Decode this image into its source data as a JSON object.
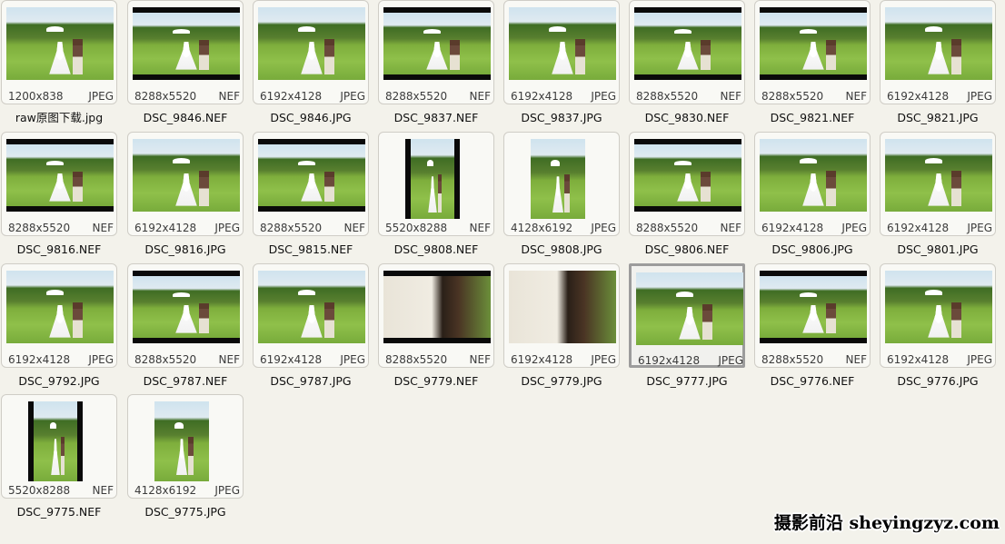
{
  "items": [
    {
      "name": "raw原图下载.jpg",
      "dims": "1200x838",
      "type": "JPEG",
      "thumb": "square",
      "selected": false
    },
    {
      "name": "DSC_9846.NEF",
      "dims": "8288x5520",
      "type": "NEF",
      "thumb": "landscape-letterbox",
      "selected": false
    },
    {
      "name": "DSC_9846.JPG",
      "dims": "6192x4128",
      "type": "JPEG",
      "thumb": "landscape",
      "selected": false
    },
    {
      "name": "DSC_9837.NEF",
      "dims": "8288x5520",
      "type": "NEF",
      "thumb": "landscape-letterbox",
      "selected": false
    },
    {
      "name": "DSC_9837.JPG",
      "dims": "6192x4128",
      "type": "JPEG",
      "thumb": "landscape",
      "selected": false
    },
    {
      "name": "DSC_9830.NEF",
      "dims": "8288x5520",
      "type": "NEF",
      "thumb": "landscape-letterbox",
      "selected": false
    },
    {
      "name": "DSC_9821.NEF",
      "dims": "8288x5520",
      "type": "NEF",
      "thumb": "landscape-letterbox",
      "selected": false
    },
    {
      "name": "DSC_9821.JPG",
      "dims": "6192x4128",
      "type": "JPEG",
      "thumb": "landscape",
      "selected": false
    },
    {
      "name": "DSC_9816.NEF",
      "dims": "8288x5520",
      "type": "NEF",
      "thumb": "landscape-letterbox",
      "selected": false
    },
    {
      "name": "DSC_9816.JPG",
      "dims": "6192x4128",
      "type": "JPEG",
      "thumb": "landscape",
      "selected": false
    },
    {
      "name": "DSC_9815.NEF",
      "dims": "8288x5520",
      "type": "NEF",
      "thumb": "landscape-letterbox",
      "selected": false
    },
    {
      "name": "DSC_9808.NEF",
      "dims": "5520x8288",
      "type": "NEF",
      "thumb": "portrait-pillar",
      "selected": false
    },
    {
      "name": "DSC_9808.JPG",
      "dims": "4128x6192",
      "type": "JPEG",
      "thumb": "portrait",
      "selected": false
    },
    {
      "name": "DSC_9806.NEF",
      "dims": "8288x5520",
      "type": "NEF",
      "thumb": "landscape-letterbox",
      "selected": false
    },
    {
      "name": "DSC_9806.JPG",
      "dims": "6192x4128",
      "type": "JPEG",
      "thumb": "landscape",
      "selected": false
    },
    {
      "name": "DSC_9801.JPG",
      "dims": "6192x4128",
      "type": "JPEG",
      "thumb": "landscape",
      "selected": false
    },
    {
      "name": "DSC_9792.JPG",
      "dims": "6192x4128",
      "type": "JPEG",
      "thumb": "landscape",
      "selected": false
    },
    {
      "name": "DSC_9787.NEF",
      "dims": "8288x5520",
      "type": "NEF",
      "thumb": "landscape-letterbox",
      "selected": false
    },
    {
      "name": "DSC_9787.JPG",
      "dims": "6192x4128",
      "type": "JPEG",
      "thumb": "landscape",
      "selected": false
    },
    {
      "name": "DSC_9779.NEF",
      "dims": "8288x5520",
      "type": "NEF",
      "thumb": "closeup-letterbox",
      "selected": false
    },
    {
      "name": "DSC_9779.JPG",
      "dims": "6192x4128",
      "type": "JPEG",
      "thumb": "closeup",
      "selected": false
    },
    {
      "name": "DSC_9777.JPG",
      "dims": "6192x4128",
      "type": "JPEG",
      "thumb": "landscape",
      "selected": true
    },
    {
      "name": "DSC_9776.NEF",
      "dims": "8288x5520",
      "type": "NEF",
      "thumb": "landscape-letterbox",
      "selected": false
    },
    {
      "name": "DSC_9776.JPG",
      "dims": "6192x4128",
      "type": "JPEG",
      "thumb": "landscape",
      "selected": false
    },
    {
      "name": "DSC_9775.NEF",
      "dims": "5520x8288",
      "type": "NEF",
      "thumb": "portrait-pillar",
      "selected": false
    },
    {
      "name": "DSC_9775.JPG",
      "dims": "4128x6192",
      "type": "JPEG",
      "thumb": "portrait",
      "selected": false
    }
  ],
  "watermark": "摄影前沿 sheyingzyz.com"
}
